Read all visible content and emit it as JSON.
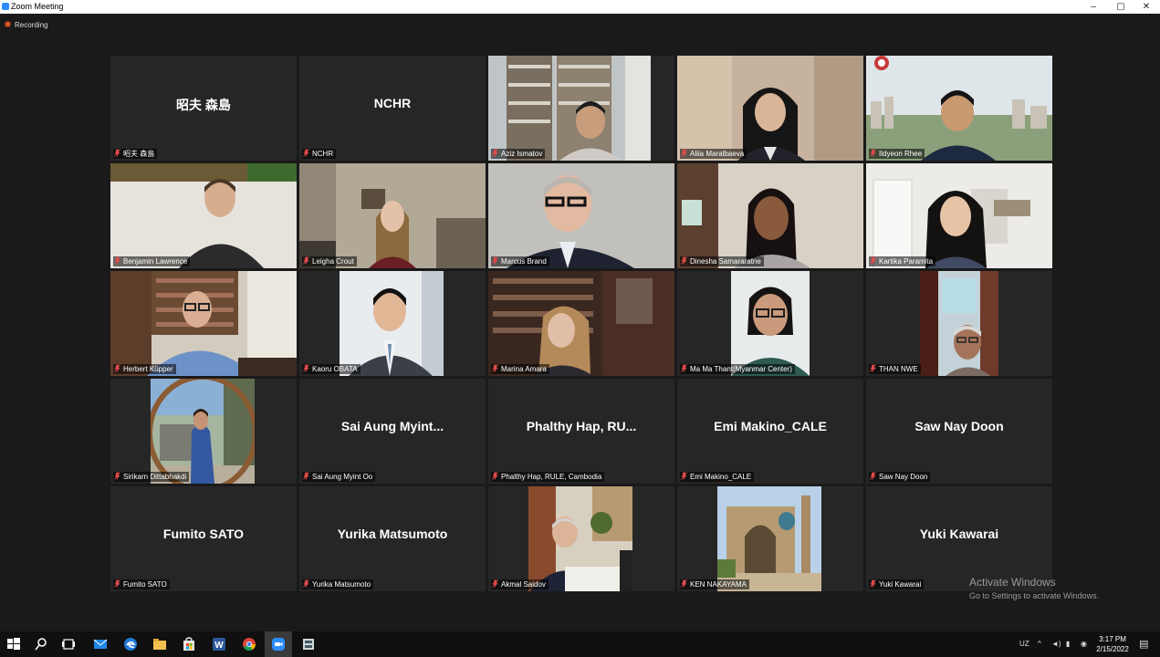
{
  "window": {
    "title": "Zoom Meeting",
    "minimize": "‒",
    "maximize": "▢",
    "close": "✕"
  },
  "recording": {
    "label": "Recording",
    "color": "#e0592a"
  },
  "active_speaker_color": "#d7e37a",
  "participants": [
    {
      "label": "昭夫 森島",
      "center": "昭夫 森島"
    },
    {
      "label": "NCHR",
      "center": "NCHR"
    },
    {
      "label": "Aziz Ismatov",
      "center": ""
    },
    {
      "label": "Aliia Maralbaeva",
      "center": ""
    },
    {
      "label": "Ildyeon Rhee",
      "center": ""
    },
    {
      "label": "Benjamin Lawrence",
      "center": ""
    },
    {
      "label": "Leigha Crout",
      "center": ""
    },
    {
      "label": "Marcus Brand",
      "center": ""
    },
    {
      "label": "Dinesha Samararatne",
      "center": "",
      "active": true
    },
    {
      "label": "Kartika Paramita",
      "center": ""
    },
    {
      "label": "Herbert Küpper",
      "center": ""
    },
    {
      "label": "Kaoru OBATA",
      "center": ""
    },
    {
      "label": "Marina Amara",
      "center": ""
    },
    {
      "label": "Ma Ma Thant(Myanmar Center)",
      "center": ""
    },
    {
      "label": "THAN NWE",
      "center": ""
    },
    {
      "label": "Sirikarn Dittabhakdi",
      "center": ""
    },
    {
      "label": "Sai Aung Myint Oo",
      "center": "Sai Aung Myint..."
    },
    {
      "label": "Phalthy Hap, RULE, Cambodia",
      "center": "Phalthy Hap, RU..."
    },
    {
      "label": "Emi Makino_CALE",
      "center": "Emi Makino_CALE"
    },
    {
      "label": "Saw Nay Doon",
      "center": "Saw Nay Doon"
    },
    {
      "label": "Fumito SATO",
      "center": "Fumito SATO"
    },
    {
      "label": "Yurika Matsumoto",
      "center": "Yurika Matsumoto"
    },
    {
      "label": "Akmal Saidov",
      "center": ""
    },
    {
      "label": "KEN NAKAYAMA",
      "center": ""
    },
    {
      "label": "Yuki Kawarai",
      "center": "Yuki Kawarai"
    }
  ],
  "watermark": {
    "title": "Activate Windows",
    "subtitle": "Go to Settings to activate Windows."
  },
  "taskbar": {
    "icons": [
      "windows-start-icon",
      "search-icon",
      "task-view-icon",
      "mail-icon",
      "edge-icon",
      "file-explorer-icon",
      "store-icon",
      "word-icon",
      "chrome-icon",
      "zoom-icon",
      "network-app-icon"
    ],
    "language": "UZ",
    "time": "3:17 PM",
    "date": "2/15/2022"
  }
}
